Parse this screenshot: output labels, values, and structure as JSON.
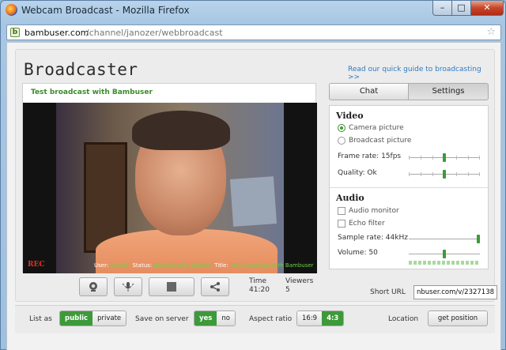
{
  "window": {
    "title": "Webcam Broadcast - Mozilla Firefox",
    "minimize": "–",
    "maximize": "□",
    "close": "✕"
  },
  "urlbar": {
    "host": "bambuser.com",
    "path": "/channel/janozer/webbroadcast"
  },
  "page": {
    "title": "Broadcaster",
    "guide_link": "Read our quick guide to broadcasting >>"
  },
  "video": {
    "broadcast_title": "Test broadcast with Bambuser",
    "rec": "REC",
    "status_line": {
      "user_label": "User:",
      "user_value": "janozer",
      "status_label": "Status:",
      "status_value": "Broadcasting (public)",
      "title_label": "Title:",
      "title_value": "Test broadcast with Bambuser"
    }
  },
  "stats": {
    "time_label": "Time",
    "time_value": "41:20",
    "viewers_label": "Viewers",
    "viewers_value": "5"
  },
  "tabs": {
    "chat": "Chat",
    "settings": "Settings"
  },
  "settings": {
    "video_title": "Video",
    "camera_picture": "Camera picture",
    "broadcast_picture": "Broadcast picture",
    "frame_rate": "Frame rate: 15fps",
    "frame_rate_level": 0.5,
    "quality": "Quality: Ok",
    "quality_level": 0.5,
    "audio_title": "Audio",
    "audio_monitor": "Audio monitor",
    "echo_filter": "Echo filter",
    "sample_rate": "Sample rate: 44kHz",
    "sample_rate_level": 1.0,
    "volume": "Volume: 50",
    "volume_level": 0.5
  },
  "short_url": {
    "label": "Short URL",
    "value": "nbuser.com/v/2327138"
  },
  "bottom": {
    "list_as_label": "List as",
    "list_public": "public",
    "list_private": "private",
    "save_label": "Save on server",
    "save_yes": "yes",
    "save_no": "no",
    "aspect_label": "Aspect ratio",
    "aspect_169": "16:9",
    "aspect_43": "4:3",
    "location_label": "Location",
    "get_position": "get position"
  },
  "colors": {
    "accent_green": "#3d9a3a",
    "link_blue": "#2f7bc0",
    "rec_red": "#e8301e"
  }
}
